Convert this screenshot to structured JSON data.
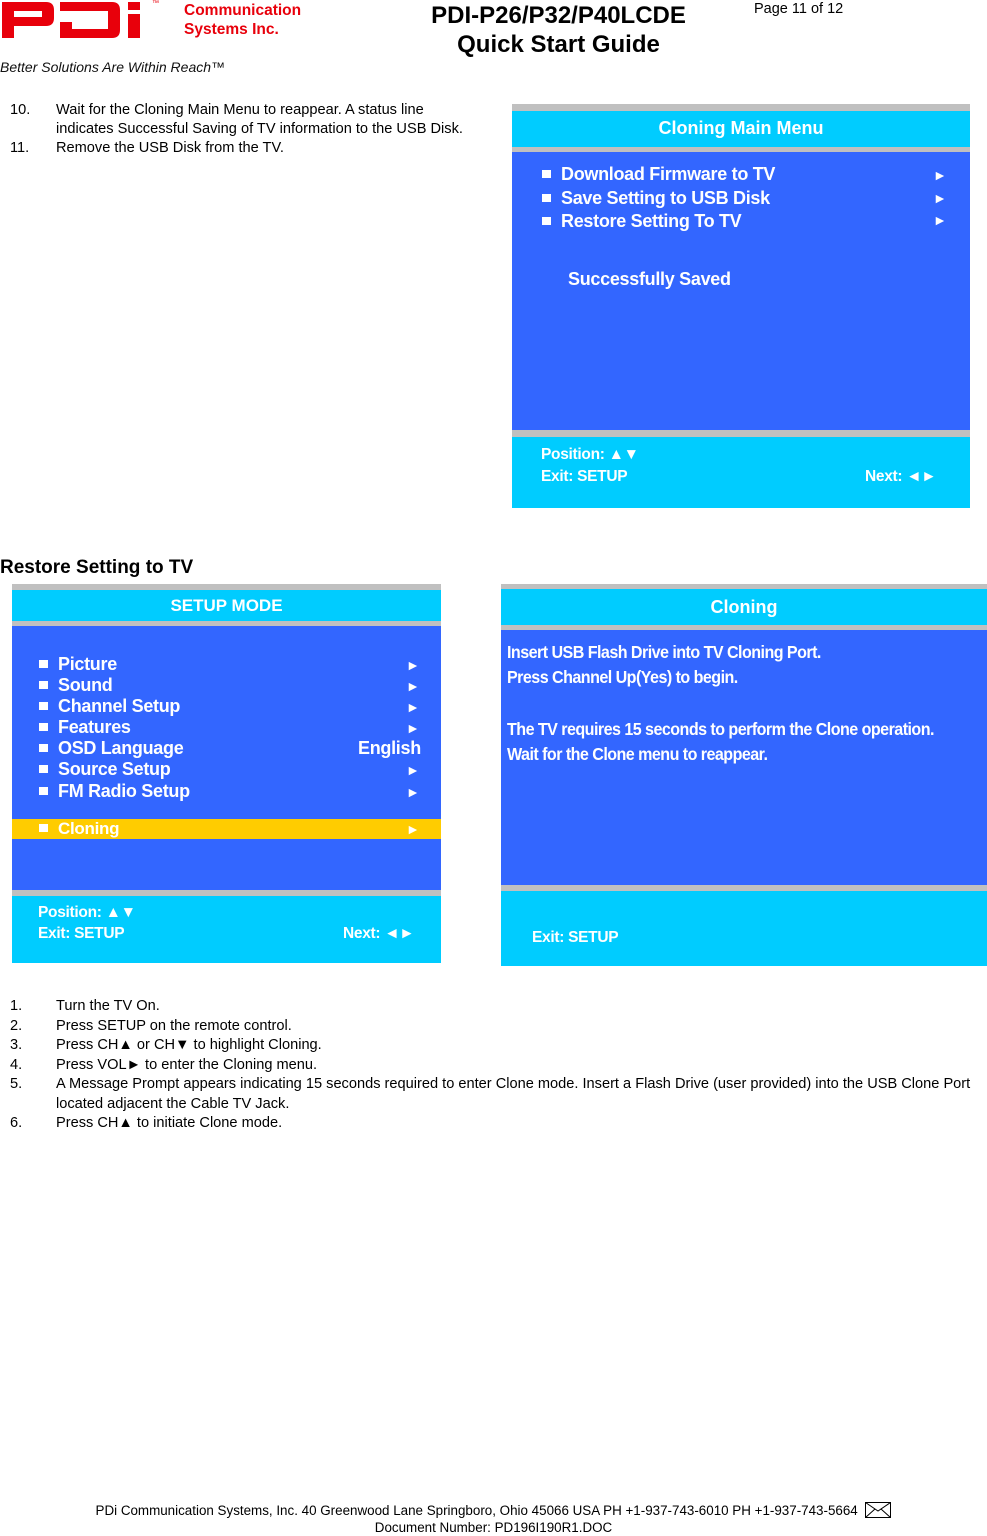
{
  "header": {
    "logo_text": "PDi",
    "trademark": "™",
    "company_line1": "Communication",
    "company_line2": "Systems Inc.",
    "tagline": "Better Solutions Are Within Reach™",
    "title_line1": "PDI-P26/P32/P40LCDE",
    "title_line2": "Quick Start Guide",
    "page_label": "Page 11 of 12"
  },
  "save_steps": [
    {
      "num": "10.",
      "text": "Wait for the Cloning Main Menu to reappear.  A status line indicates Successful Saving of TV information to the USB Disk."
    },
    {
      "num": "11.",
      "text": "Remove the USB Disk from the TV."
    }
  ],
  "cloning_main_menu": {
    "title": "Cloning Main Menu",
    "items": [
      {
        "label": "Download Firmware to TV",
        "arrow": "►"
      },
      {
        "label": "Save Setting to USB Disk",
        "arrow": "►"
      },
      {
        "label": "Restore Setting To TV",
        "arrow": "►"
      }
    ],
    "status": "Successfully Saved",
    "footer": {
      "position": "Position: ▲▼",
      "exit": "Exit: SETUP",
      "next": "Next: ◄►"
    }
  },
  "section_heading": "Restore Setting to TV",
  "setup_mode": {
    "title": "SETUP MODE",
    "items": [
      {
        "label": "Picture",
        "value": "►"
      },
      {
        "label": "Sound",
        "value": "►"
      },
      {
        "label": "Channel Setup",
        "value": "►"
      },
      {
        "label": "Features",
        "value": "►"
      },
      {
        "label": "OSD Language",
        "value": "English"
      },
      {
        "label": "Source Setup",
        "value": "►"
      },
      {
        "label": "FM Radio Setup",
        "value": "►"
      }
    ],
    "highlighted": {
      "label": "Cloning",
      "value": "►"
    },
    "footer": {
      "position": "Position: ▲▼",
      "exit": "Exit: SETUP",
      "next": "Next: ◄►"
    }
  },
  "cloning_prompt": {
    "title": "Cloning",
    "lines": [
      "Insert USB Flash Drive into TV Cloning Port.",
      "Press Channel Up(Yes) to begin.",
      "The TV requires 15 seconds to perform the Clone operation.",
      "Wait for the Clone menu to reappear."
    ],
    "footer": {
      "exit": "Exit: SETUP"
    }
  },
  "restore_steps": [
    {
      "num": "1.",
      "text": "Turn the TV On."
    },
    {
      "num": "2.",
      "text": "Press SETUP on the remote control."
    },
    {
      "num": "3.",
      "text": "Press CH▲ or CH▼ to highlight Cloning."
    },
    {
      "num": "4.",
      "text": "Press VOL► to enter the Cloning menu."
    },
    {
      "num": "5.",
      "text": "A Message Prompt appears indicating 15 seconds required to enter Clone mode.  Insert a Flash Drive (user provided) into the USB Clone Port located adjacent the Cable TV Jack."
    },
    {
      "num": "6.",
      "text": "Press CH▲ to initiate Clone mode."
    }
  ],
  "footer": {
    "address_line": "PDi Communication Systems, Inc.   40 Greenwood Lane   Springboro, Ohio 45066 USA   PH +1-937-743-6010 PH +1-937-743-5664",
    "doc_number": "Document Number:  PD196I190R1.DOC",
    "mail_icon": "envelope-icon"
  },
  "colors": {
    "brand_red": "#e8000b",
    "osd_cyan": "#00ccff",
    "osd_blue": "#3366ff",
    "osd_highlight": "#ffcc00",
    "osd_separator": "#c0c0c0"
  }
}
